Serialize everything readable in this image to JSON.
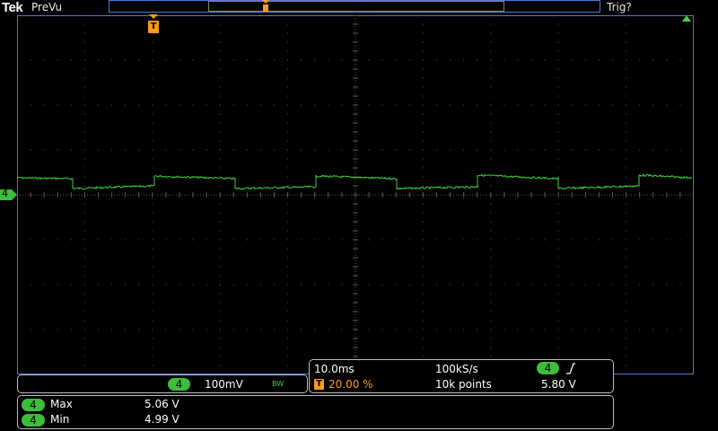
{
  "header": {
    "brand": "Tek",
    "mode": "PreVu",
    "trigger_status": "Trig?"
  },
  "markers": {
    "trigger_position_label": "T",
    "channel_label": "4"
  },
  "channel_box": {
    "channel": "4",
    "scale": "100mV",
    "bandwidth_limit": "BW"
  },
  "timebase_box": {
    "time_per_div": "10.0ms",
    "sample_rate": "100kS/s",
    "trigger_channel": "4",
    "trigger_slope_icon": "rising-edge-icon",
    "trigger_icon_label": "T",
    "trigger_position": "20.00 %",
    "record_length": "10k points",
    "trigger_level": "5.80 V"
  },
  "measurements": [
    {
      "channel": "4",
      "name": "Max",
      "value": "5.06 V"
    },
    {
      "channel": "4",
      "name": "Min",
      "value": "4.99 V"
    }
  ],
  "colors": {
    "trace": "#3bd43b",
    "trigger": "#ff9a1a",
    "graticule": "#5a5a5a",
    "frame": "#4a7bd6"
  }
}
